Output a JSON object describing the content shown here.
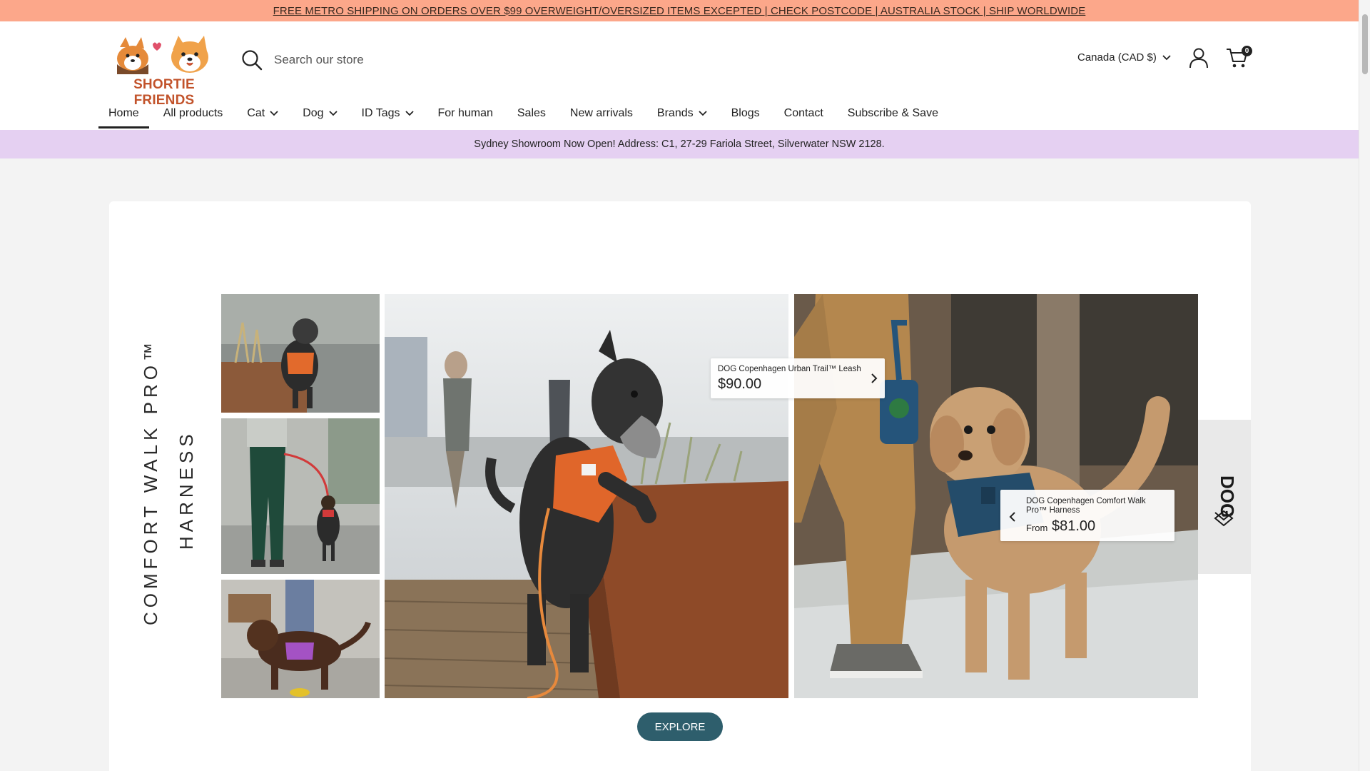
{
  "promo_bar": {
    "text": "FREE METRO SHIPPING ON ORDERS OVER $99 OVERWEIGHT/OVERSIZED ITEMS EXCEPTED | CHECK POSTCODE | AUSTRALIA STOCK | SHIP WORLDWIDE"
  },
  "header": {
    "logo_text": "SHORTIE FRIENDS",
    "search_placeholder": "Search our store",
    "currency": "Canada (CAD $)",
    "cart_count": "0"
  },
  "nav": {
    "items": [
      {
        "label": "Home",
        "active": true,
        "dropdown": false
      },
      {
        "label": "All products",
        "dropdown": false
      },
      {
        "label": "Cat",
        "dropdown": true
      },
      {
        "label": "Dog",
        "dropdown": true
      },
      {
        "label": "ID Tags",
        "dropdown": true
      },
      {
        "label": "For human",
        "dropdown": false
      },
      {
        "label": "Sales",
        "dropdown": false
      },
      {
        "label": "New arrivals",
        "dropdown": false
      },
      {
        "label": "Brands",
        "dropdown": true
      },
      {
        "label": "Blogs",
        "dropdown": false
      },
      {
        "label": "Contact",
        "dropdown": false
      },
      {
        "label": "Subscribe & Save",
        "dropdown": false
      }
    ]
  },
  "announcement": {
    "text": "Sydney Showroom Now Open! Address: C1, 27-29 Fariola Street, Silverwater NSW 2128."
  },
  "hero": {
    "title_line1": "COMFORT WALK PRO™",
    "title_line2": "HARNESS",
    "hotspot_leash": {
      "name": "DOG Copenhagen Urban Trail™ Leash",
      "price": "$90.00"
    },
    "hotspot_harness": {
      "name": "DOG Copenhagen Comfort Walk Pro™ Harness",
      "from_label": "From",
      "price": "$81.00"
    },
    "explore_label": "EXPLORE"
  },
  "colors": {
    "promo_bg": "#fca78a",
    "announce_bg": "#e5d0f2",
    "button_bg": "#2e5e6c",
    "brand_orange": "#c2532b"
  }
}
